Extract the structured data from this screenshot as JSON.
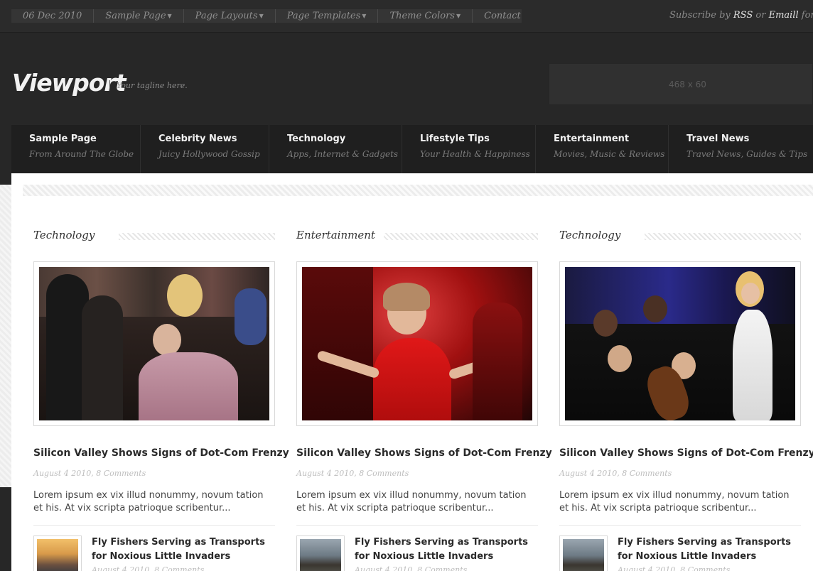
{
  "topbar": {
    "date": "06 Dec 2010",
    "menu": [
      {
        "label": "Sample Page",
        "has_dropdown": true
      },
      {
        "label": "Page Layouts",
        "has_dropdown": true
      },
      {
        "label": "Page Templates",
        "has_dropdown": true
      },
      {
        "label": "Theme Colors",
        "has_dropdown": true
      },
      {
        "label": "Contact",
        "has_dropdown": false
      }
    ],
    "subscribe": {
      "prefix": "Subscribe by",
      "rss": "RSS",
      "or": "or",
      "email": "Emaill",
      "suffix": "for updat"
    }
  },
  "header": {
    "logo": "Viewport",
    "tagline": "Your tagline here.",
    "ad_text": "468 x 60"
  },
  "main_nav": [
    {
      "title": "Sample Page",
      "subtitle": "From Around The Globe"
    },
    {
      "title": "Celebrity News",
      "subtitle": "Juicy Hollywood Gossip"
    },
    {
      "title": "Technology",
      "subtitle": "Apps, Internet & Gadgets"
    },
    {
      "title": "Lifestyle Tips",
      "subtitle": "Your Health & Happiness"
    },
    {
      "title": "Entertainment",
      "subtitle": "Movies, Music & Reviews"
    },
    {
      "title": "Travel News",
      "subtitle": "Travel News, Guides & Tips"
    }
  ],
  "columns": [
    {
      "category": "Technology",
      "post": {
        "title": "Silicon Valley Shows Signs of Dot-Com Frenzy",
        "meta": "August 4 2010, 8 Comments",
        "excerpt": "Lorem ipsum ex vix illud nonummy, novum tation et his. At vix scripta patrioque scribentur..."
      },
      "mini": {
        "title": "Fly Fishers Serving as Transports for Noxious Little Invaders",
        "meta": "August 4 2010, 8 Comments"
      }
    },
    {
      "category": "Entertainment",
      "post": {
        "title": "Silicon Valley Shows Signs of Dot-Com Frenzy",
        "meta": "August 4 2010, 8 Comments",
        "excerpt": "Lorem ipsum ex vix illud nonummy, novum tation et his. At vix scripta patrioque scribentur..."
      },
      "mini": {
        "title": "Fly Fishers Serving as Transports for Noxious Little Invaders",
        "meta": "August 4 2010, 8 Comments"
      }
    },
    {
      "category": "Technology",
      "post": {
        "title": "Silicon Valley Shows Signs of Dot-Com Frenzy",
        "meta": "August 4 2010, 8 Comments",
        "excerpt": "Lorem ipsum ex vix illud nonummy, novum tation et his. At vix scripta patrioque scribentur..."
      },
      "mini": {
        "title": "Fly Fishers Serving as Transports for Noxious Little Invaders",
        "meta": "August 4 2010, 8 Comments"
      }
    }
  ],
  "colors": {
    "page_bg": "#272727",
    "nav_bg": "#1f1f1f",
    "content_bg": "#ffffff",
    "heading_text": "#2a2a2a",
    "meta_text": "#bdbdbd"
  }
}
